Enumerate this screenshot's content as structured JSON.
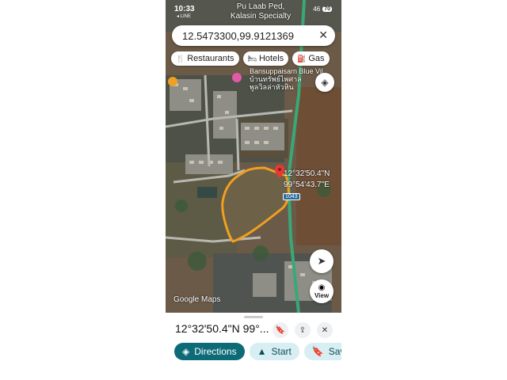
{
  "status_bar": {
    "time": "10:33",
    "carrier_line": "◂ LINE",
    "signal": "46",
    "battery": "70"
  },
  "top_place": {
    "line1": "Pu Laab Ped,",
    "line2": "Kalasin Specialty"
  },
  "search": {
    "value": "12.5473300,99.9121369",
    "clear_icon": "close-icon"
  },
  "chips": [
    {
      "icon": "fork-knife-icon",
      "label": "Restaurants"
    },
    {
      "icon": "bed-icon",
      "label": "Hotels"
    },
    {
      "icon": "gas-pump-icon",
      "label": "Gas"
    }
  ],
  "poi": {
    "name_en": "Bansuppaisarn Blue Vil",
    "name_th1": "บ้านทรัพย์ไพศาล",
    "name_th2": "พูลวิลล่าหัวหิน"
  },
  "marker": {
    "lat_label": "12°32'50.4\"N",
    "lon_label": "99°54'43.7\"E"
  },
  "road_number": "1043",
  "map_attribution": "Google Maps",
  "view_button": {
    "label": "View"
  },
  "sheet": {
    "title": "12°32'50.4\"N 99°..."
  },
  "actions": {
    "directions": "Directions",
    "start": "Start",
    "save": "Save"
  },
  "colors": {
    "accent": "#0d6b78",
    "boundary": "#f0a020",
    "marker": "#e53935",
    "road": "#3aa876"
  }
}
